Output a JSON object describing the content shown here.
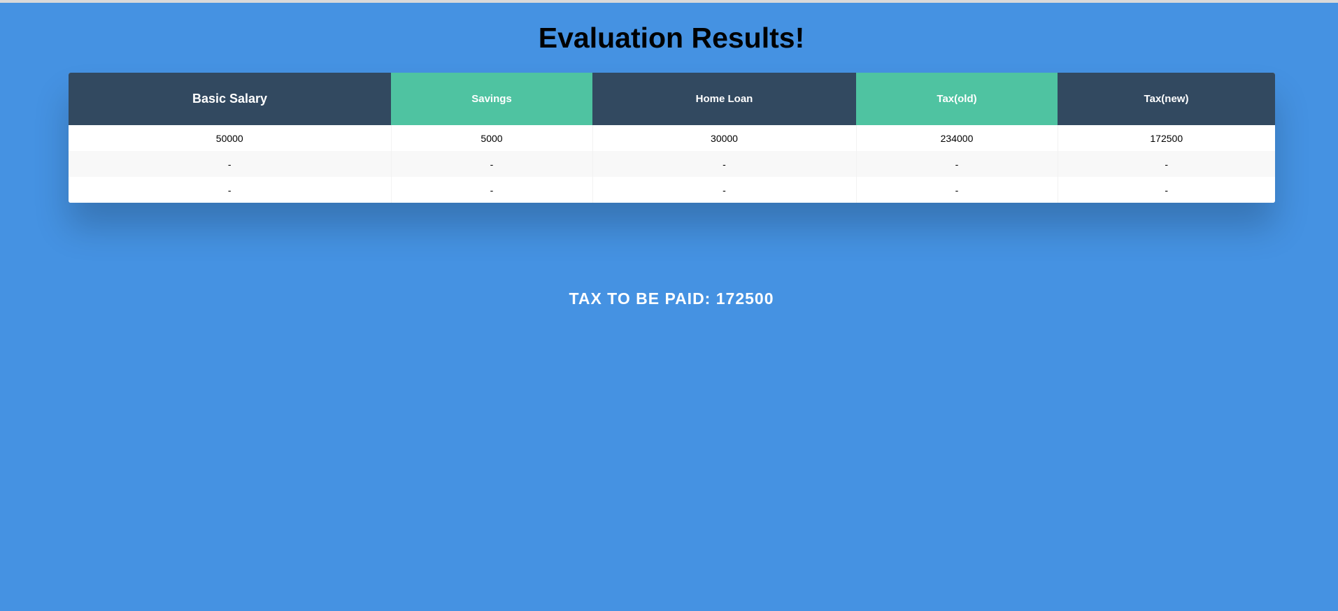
{
  "page": {
    "title": "Evaluation Results!"
  },
  "table": {
    "headers": [
      "Basic Salary",
      "Savings",
      "Home Loan",
      "Tax(old)",
      "Tax(new)"
    ],
    "rows": [
      [
        "50000",
        "5000",
        "30000",
        "234000",
        "172500"
      ],
      [
        "-",
        "-",
        "-",
        "-",
        "-"
      ],
      [
        "-",
        "-",
        "-",
        "-",
        "-"
      ]
    ]
  },
  "summary": {
    "tax_to_pay": "TAX TO BE PAID: 172500"
  },
  "colors": {
    "background": "#4592e2",
    "header_dark": "#324960",
    "header_teal": "#4fc3a1",
    "row_alt": "#f8f8f8"
  }
}
